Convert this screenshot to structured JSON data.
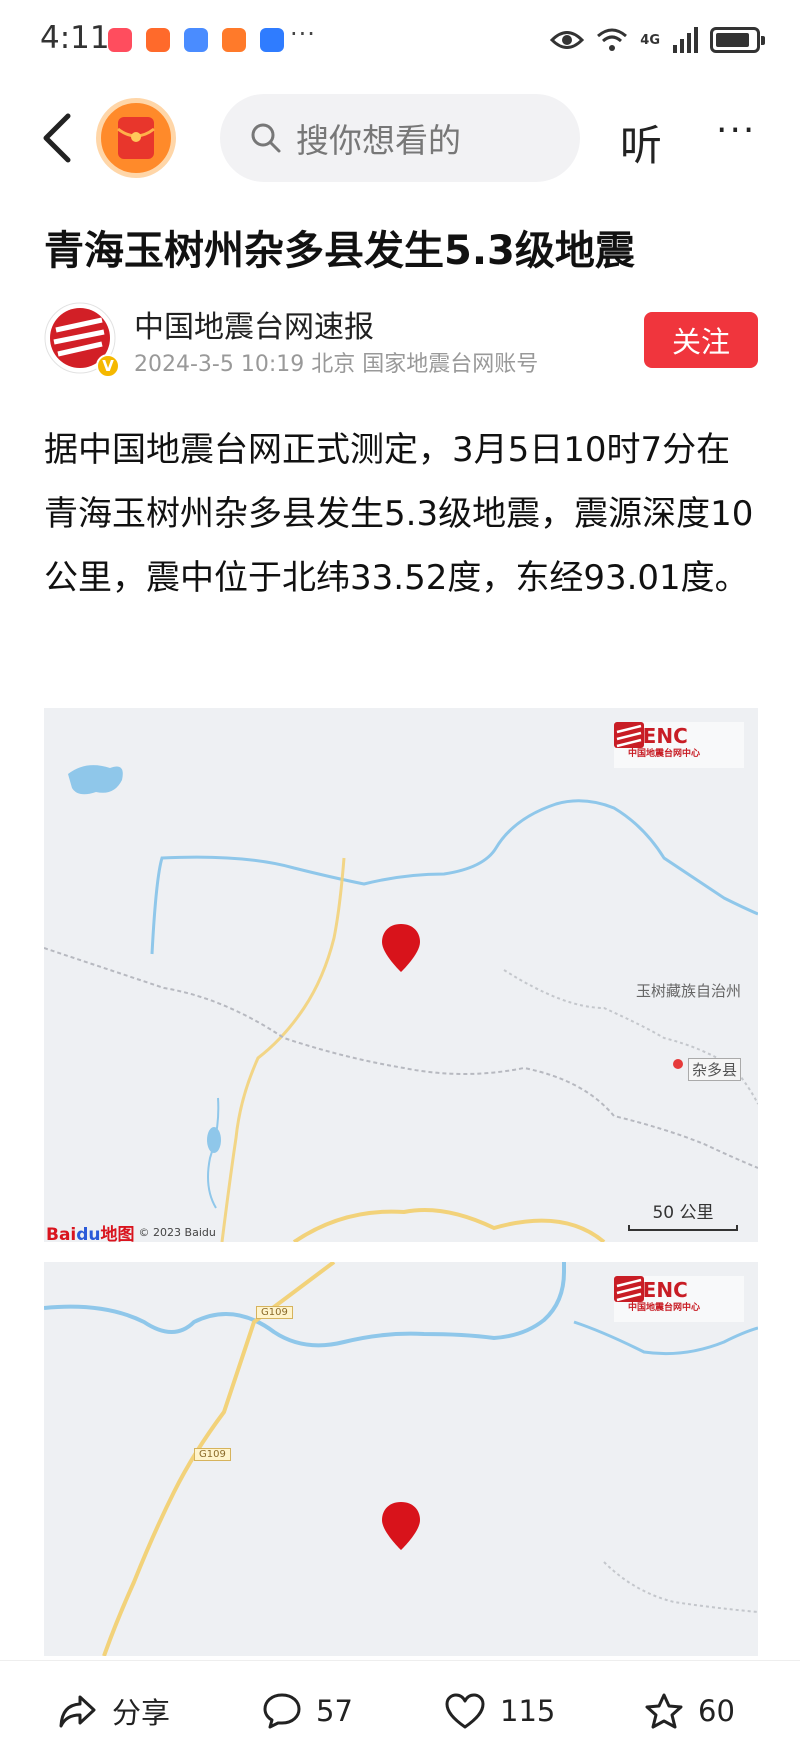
{
  "status_bar": {
    "time": "4:11",
    "network": "4G",
    "notification_colors": [
      "#ff4d5e",
      "#ff6a2b",
      "#4a8cff",
      "#ff7a2a",
      "#2f7cff"
    ]
  },
  "nav": {
    "search_placeholder": "搜你想看的",
    "listen_label": "听",
    "more_label": "···"
  },
  "article": {
    "title": "青海玉树州杂多县发生5.3级地震",
    "author": {
      "name": "中国地震台网速报",
      "meta": "2024-3-5  10:19  北京  国家地震台网账号",
      "follow_label": "关注",
      "verified_badge": "V"
    },
    "body": "据中国地震台网正式测定，3月5日10时7分在青海玉树州杂多县发生5.3级地震，震源深度10公里，震中位于北纬33.52度，东经93.01度。"
  },
  "map1": {
    "brand": "CENC",
    "brand_sub": "中国地震台网中心",
    "region_label": "玉树藏族自治州",
    "county_label": "杂多县",
    "scale_label": "50 公里",
    "map_provider": "Bai",
    "map_provider_du": "du",
    "map_provider_suffix": "地图",
    "copyright": "© 2023 Baidu"
  },
  "map2": {
    "brand": "CENC",
    "brand_sub": "中国地震台网中心",
    "road_labels": [
      "G109",
      "G109"
    ]
  },
  "bottom_bar": {
    "share_label": "分享",
    "comments": "57",
    "likes": "115",
    "favorites": "60"
  },
  "colors": {
    "accent_red": "#f0353d",
    "river_blue": "#8fc7ea",
    "road_yellow": "#f2d27a",
    "pin_red": "#d8131b"
  }
}
